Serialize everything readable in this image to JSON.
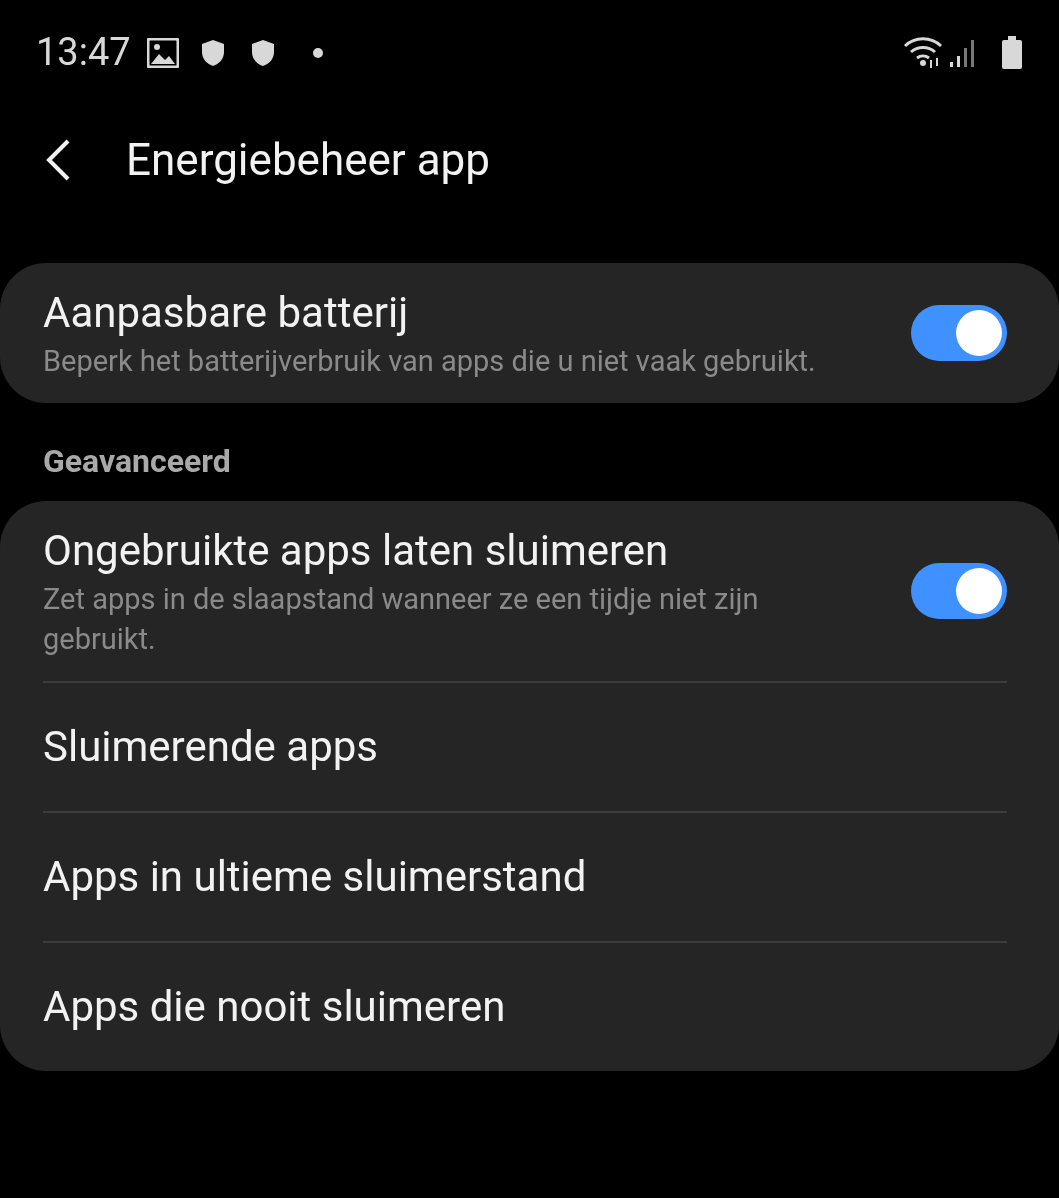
{
  "status_bar": {
    "time": "13:47"
  },
  "header": {
    "title": "Energiebeheer app"
  },
  "sections": [
    {
      "items": [
        {
          "kind": "toggle",
          "title": "Aanpasbare batterij",
          "subtitle": "Beperk het batterijverbruik van apps die u niet vaak gebruikt.",
          "on": true
        }
      ]
    },
    {
      "heading": "Geavanceerd",
      "items": [
        {
          "kind": "toggle",
          "title": "Ongebruikte apps laten sluimeren",
          "subtitle": "Zet apps in de slaapstand wanneer ze een tijdje niet zijn gebruikt.",
          "on": true
        },
        {
          "kind": "link",
          "title": "Sluimerende apps"
        },
        {
          "kind": "link",
          "title": "Apps in ultieme sluimerstand"
        },
        {
          "kind": "link",
          "title": "Apps die nooit sluimeren"
        }
      ]
    }
  ]
}
